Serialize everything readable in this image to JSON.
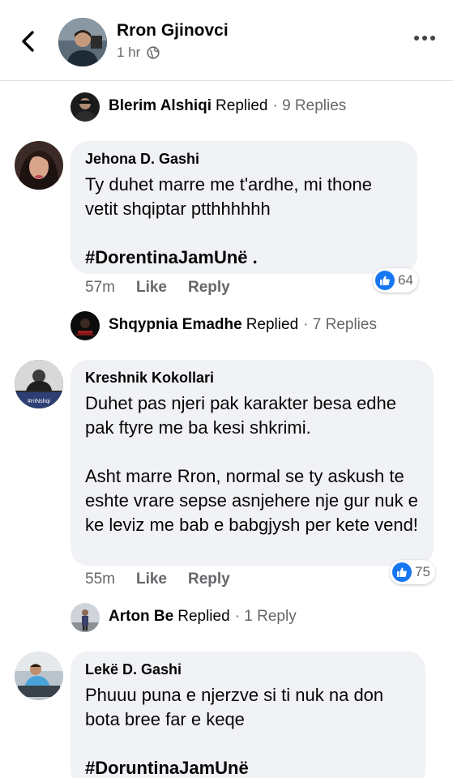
{
  "header": {
    "title": "Rron Gjinovci",
    "time": "1 hr",
    "icons": {
      "back": "chevron-left-icon",
      "audience": "globe-icon",
      "more": "more-horizontal-icon"
    }
  },
  "replies_summary": [
    {
      "name": "Blerim Alshiqi",
      "replied": "Replied",
      "count": "· 9 Replies"
    },
    {
      "name": "Shqypnia Emadhe",
      "replied": "Replied",
      "count": "· 7 Replies"
    },
    {
      "name": "Arton Be",
      "replied": "Replied",
      "count": "· 1 Reply"
    }
  ],
  "comments": [
    {
      "author": "Jehona D. Gashi",
      "text": "Ty duhet marre me t'ardhe, mi thone vetit shqiptar ptthhhhhh",
      "hashtag": "#DorentinaJamUnë .",
      "time": "57m",
      "like": "Like",
      "reply": "Reply",
      "reactions": "64"
    },
    {
      "author": "Kreshnik Kokollari",
      "text": "Duhet pas njeri pak karakter besa edhe pak ftyre me ba kesi shkrimi.",
      "text2": "Asht marre Rron, normal se ty askush te eshte vrare sepse asnjehere nje gur nuk e ke leviz me bab e babgjysh per kete vend!",
      "time": "55m",
      "like": "Like",
      "reply": "Reply",
      "reactions": "75",
      "avatar_caption": "#rriNshqi"
    },
    {
      "author": "Lekë D. Gashi",
      "text": "Phuuu puna e njerzve si ti nuk na don bota bree far e keqe",
      "hashtag": "#DoruntinaJamUnë"
    }
  ],
  "colors": {
    "bubble": "#f0f2f5",
    "muted": "#65676b",
    "like_blue": "#1877f2",
    "text": "#050505"
  }
}
